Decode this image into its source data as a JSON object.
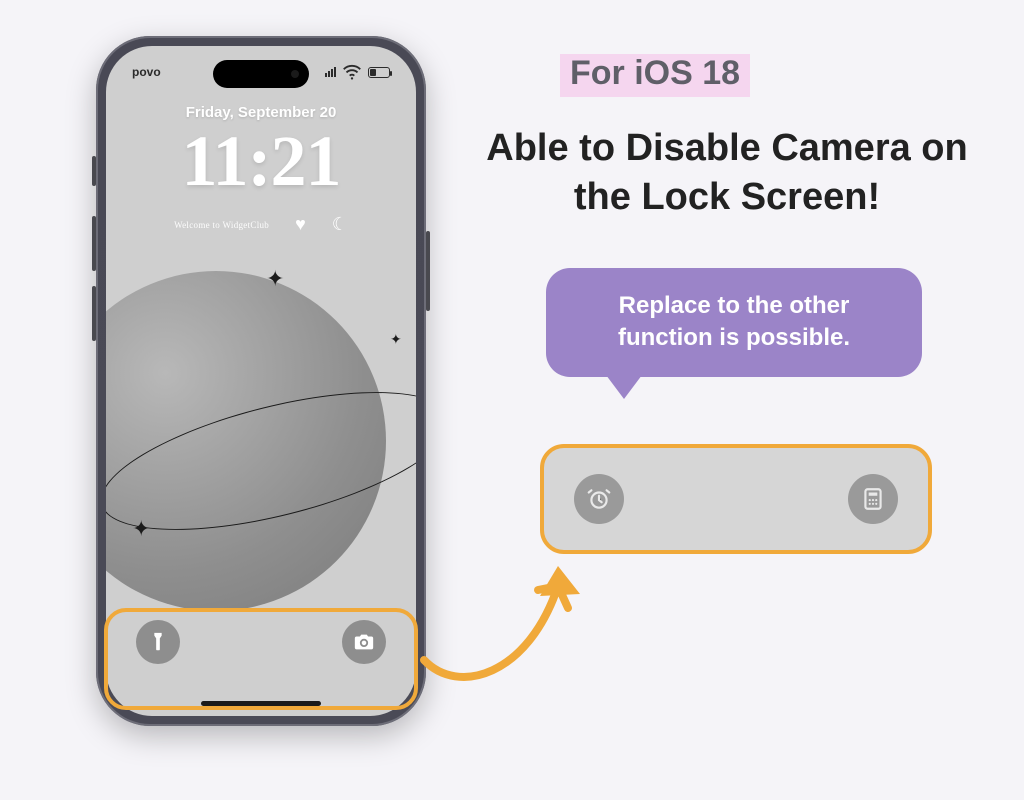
{
  "tag": "For iOS 18",
  "headline": "Able to Disable Camera on the Lock Screen!",
  "bubble": "Replace to the other function is possible.",
  "phone": {
    "carrier": "povo",
    "date": "Friday, September 20",
    "time": "11:21",
    "widget_text": "Welcome to WidgetClub",
    "buttons": {
      "left": "flashlight",
      "right": "camera"
    }
  },
  "replacement": {
    "left": "alarm",
    "right": "calculator"
  },
  "colors": {
    "accent": "#f0a93a",
    "bubble": "#9b84c8",
    "tag_bg": "#f5d6ef"
  }
}
